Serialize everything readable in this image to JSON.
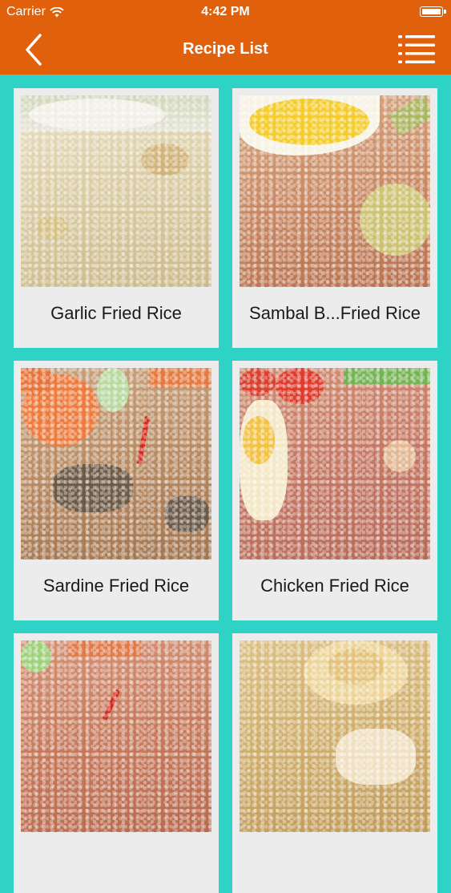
{
  "status_bar": {
    "carrier": "Carrier",
    "time": "4:42 PM"
  },
  "nav": {
    "title": "Recipe List",
    "back_icon": "chevron-left-icon",
    "menu_icon": "list-icon"
  },
  "colors": {
    "header": "#e0600c",
    "background": "#2ed3c6",
    "card": "#ececec"
  },
  "recipes": [
    {
      "name": "Garlic Fried Rice"
    },
    {
      "name": "Sambal B...Fried Rice"
    },
    {
      "name": "Sardine Fried Rice"
    },
    {
      "name": "Chicken Fried Rice"
    },
    {
      "name": ""
    },
    {
      "name": ""
    }
  ]
}
